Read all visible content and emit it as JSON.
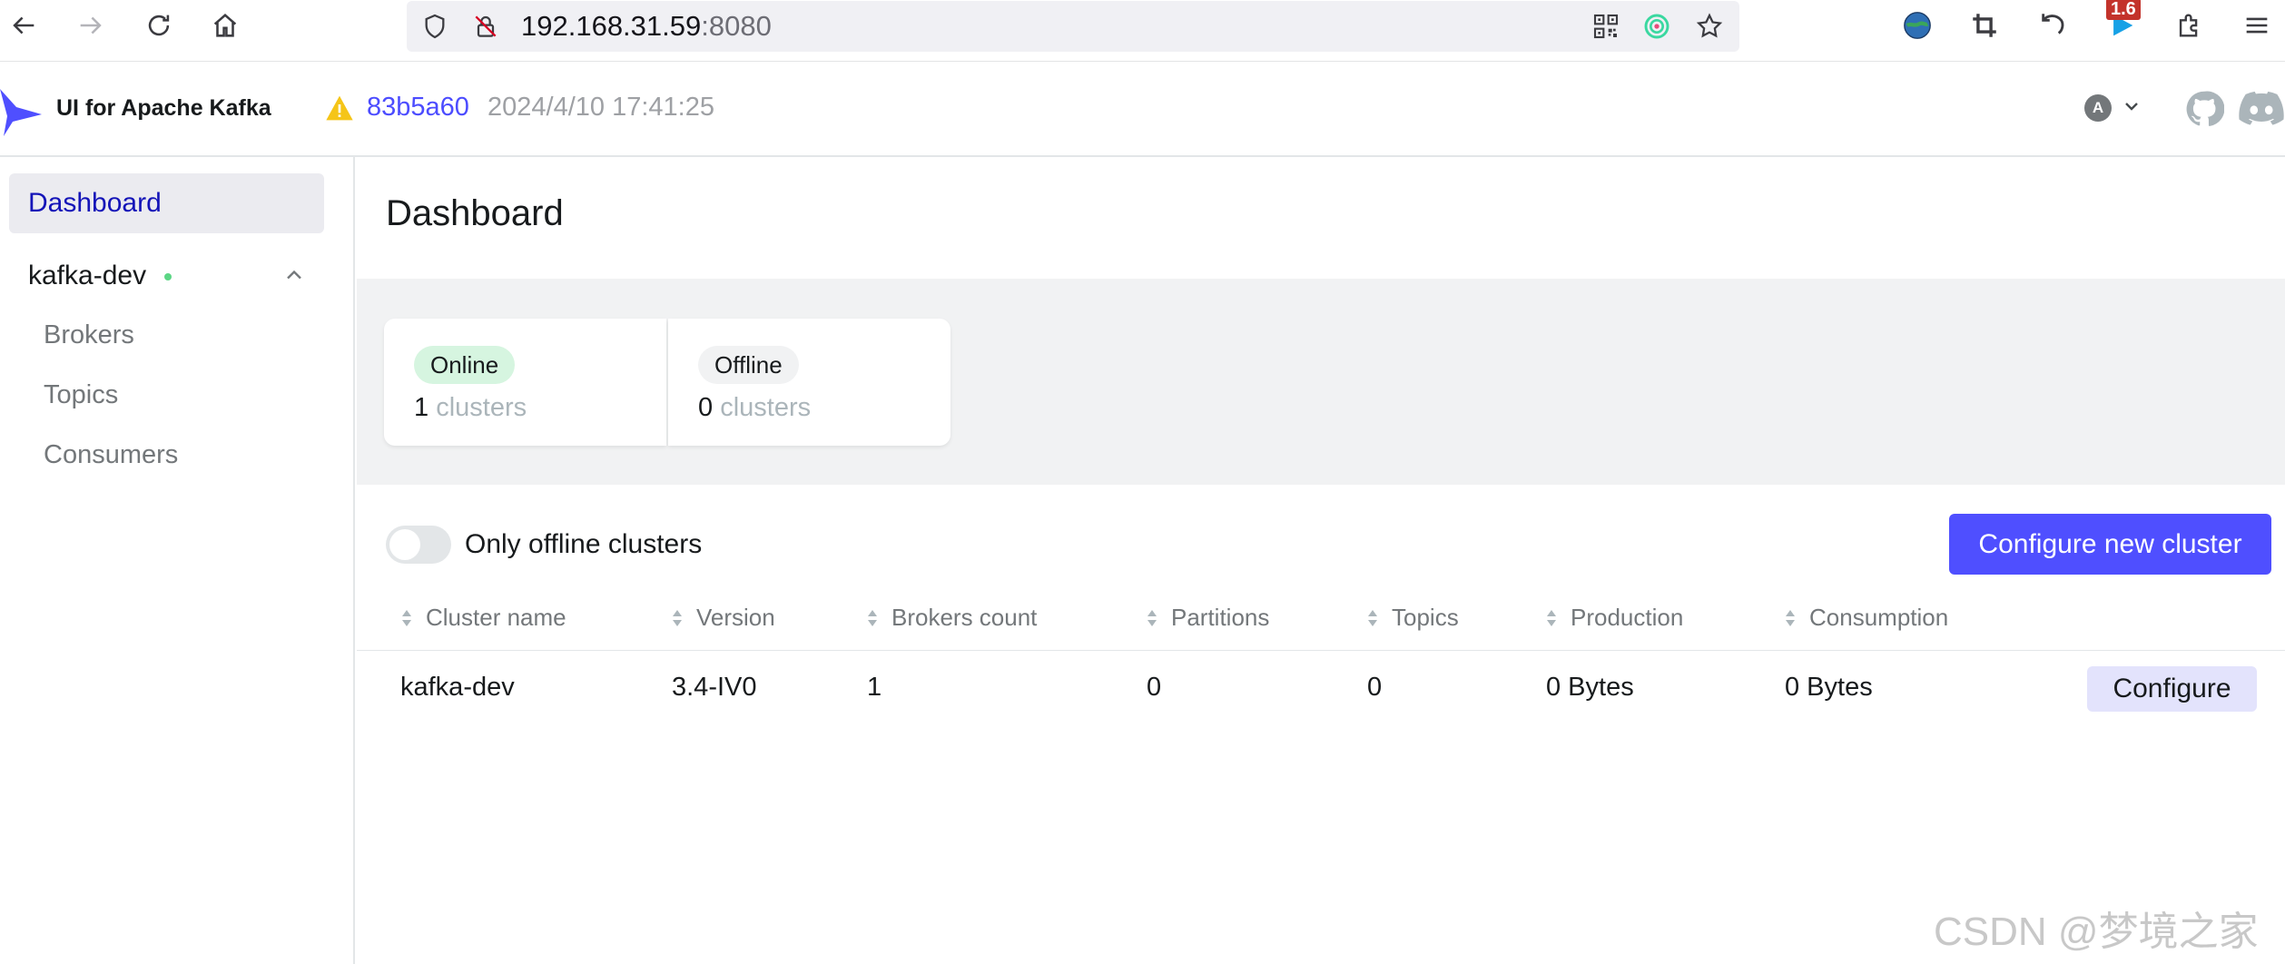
{
  "browser": {
    "url_host": "192.168.31.59",
    "url_port": ":8080",
    "extension_badge": "1.6"
  },
  "header": {
    "brand": "UI for Apache Kafka",
    "commit": "83b5a60",
    "commit_date": "2024/4/10 17:41:25",
    "user_initial": "A"
  },
  "sidebar": {
    "dashboard": "Dashboard",
    "cluster_name": "kafka-dev",
    "items": [
      "Brokers",
      "Topics",
      "Consumers"
    ]
  },
  "main": {
    "title": "Dashboard",
    "metrics": {
      "online_label": "Online",
      "online_value": "1",
      "online_unit": "clusters",
      "offline_label": "Offline",
      "offline_value": "0",
      "offline_unit": "clusters"
    },
    "toggle_label": "Only offline clusters",
    "configure_new_label": "Configure new cluster",
    "table": {
      "headers": [
        "Cluster name",
        "Version",
        "Brokers count",
        "Partitions",
        "Topics",
        "Production",
        "Consumption"
      ],
      "rows": [
        [
          "kafka-dev",
          "3.4-IV0",
          "1",
          "0",
          "0",
          "0 Bytes",
          "0 Bytes"
        ]
      ],
      "configure_label": "Configure"
    }
  },
  "watermark": "CSDN @梦境之家",
  "colors": {
    "accent": "#4f4fff",
    "online_badge": "#d6f5e0",
    "status_dot": "#5cd685",
    "sidebar_active_bg": "#ebebf0"
  }
}
